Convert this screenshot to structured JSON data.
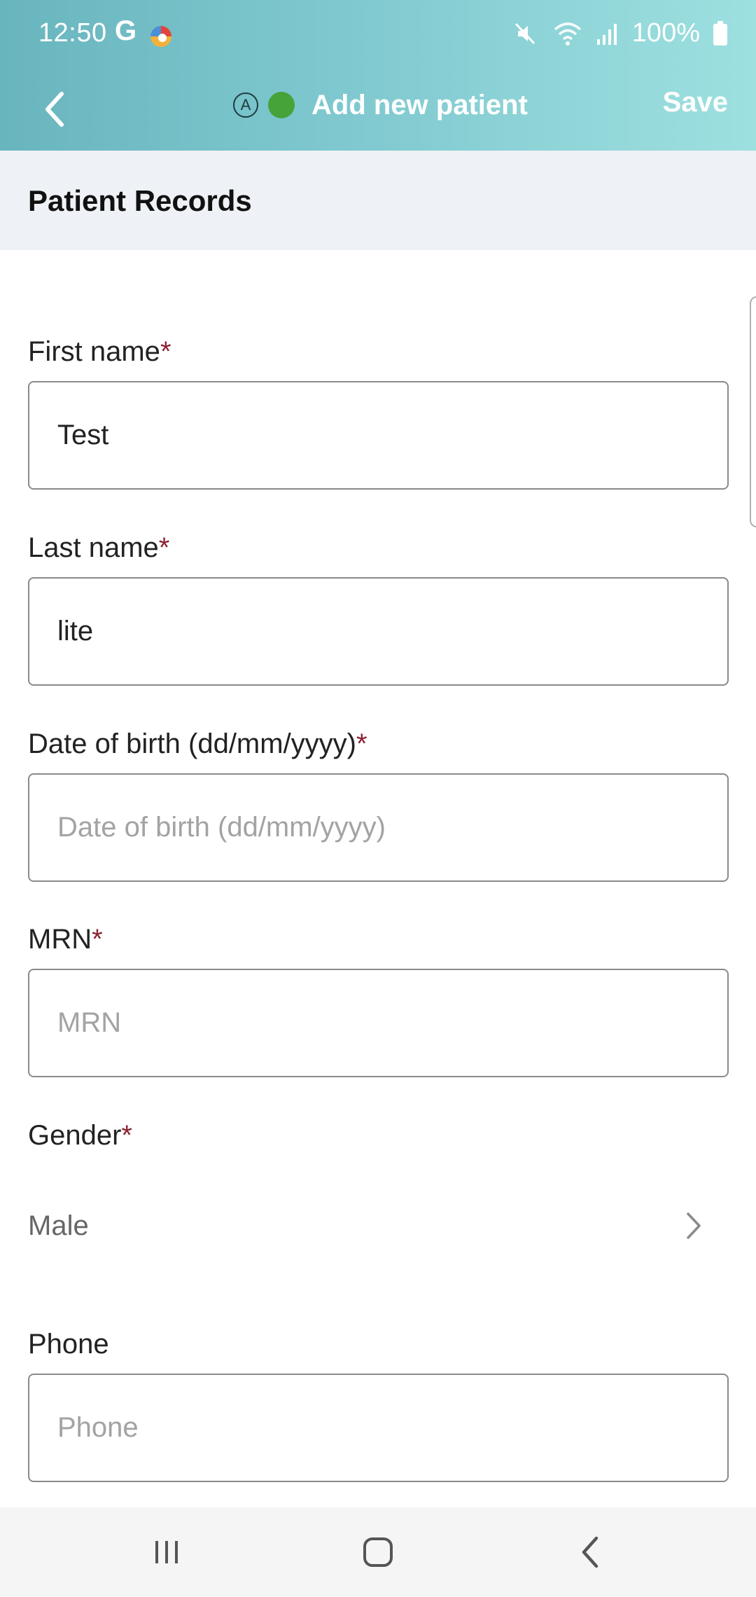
{
  "status_bar": {
    "time": "12:50",
    "g_letter": "G",
    "battery": "100%",
    "icons": [
      "mute-icon",
      "wifi-icon",
      "signal-icon",
      "battery-icon"
    ]
  },
  "app_bar": {
    "title": "Add new patient",
    "badge_letter": "A",
    "save_label": "Save",
    "status_dot_color": "#45a33a"
  },
  "section": {
    "title": "Patient Records"
  },
  "form": {
    "first_name": {
      "label": "First name",
      "required_mark": "*",
      "value": "Test",
      "placeholder": "First name"
    },
    "last_name": {
      "label": "Last name",
      "required_mark": "*",
      "value": "lite",
      "placeholder": "Last name"
    },
    "dob": {
      "label": "Date of birth (dd/mm/yyyy)",
      "required_mark": "*",
      "value": "",
      "placeholder": "Date of birth (dd/mm/yyyy)"
    },
    "mrn": {
      "label": "MRN",
      "required_mark": "*",
      "value": "",
      "placeholder": "MRN"
    },
    "gender": {
      "label": "Gender",
      "required_mark": "*",
      "value": "Male"
    },
    "phone": {
      "label": "Phone",
      "value": "",
      "placeholder": "Phone"
    }
  },
  "colors": {
    "header_gradient_start": "#69b5be",
    "header_gradient_end": "#9ee0e0",
    "required": "#8b2332",
    "section_bg": "#eef1f5"
  }
}
